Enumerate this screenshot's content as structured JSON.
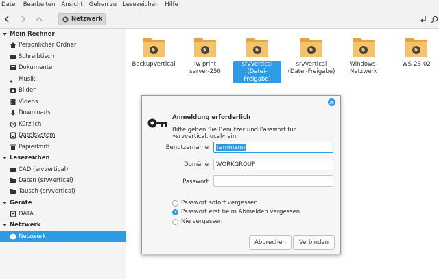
{
  "menubar": [
    "Datei",
    "Bearbeiten",
    "Ansicht",
    "Gehen zu",
    "Lesezeichen",
    "Hilfe"
  ],
  "toolbar": {
    "location": "Netzwerk"
  },
  "sidebar": {
    "sections": [
      {
        "title": "Mein Rechner",
        "items": [
          {
            "label": "Persönlicher Ordner",
            "icon": "home-icon"
          },
          {
            "label": "Schreibtisch",
            "icon": "desktop-icon"
          },
          {
            "label": "Dokumente",
            "icon": "documents-icon"
          },
          {
            "label": "Musik",
            "icon": "music-icon"
          },
          {
            "label": "Bilder",
            "icon": "pictures-icon"
          },
          {
            "label": "Videos",
            "icon": "videos-icon"
          },
          {
            "label": "Downloads",
            "icon": "downloads-icon"
          },
          {
            "label": "Kürzlich",
            "icon": "recent-icon"
          },
          {
            "label": "Dateisystem",
            "icon": "filesystem-icon"
          },
          {
            "label": "Papierkorb",
            "icon": "trash-icon"
          }
        ]
      },
      {
        "title": "Lesezeichen",
        "items": [
          {
            "label": "CAD (srvvertical)",
            "icon": "folder-icon"
          },
          {
            "label": "Daten (srvvertical)",
            "icon": "folder-icon"
          },
          {
            "label": "Tausch (srvvertical)",
            "icon": "folder-icon"
          }
        ]
      },
      {
        "title": "Geräte",
        "items": [
          {
            "label": "DATA",
            "icon": "drive-icon"
          }
        ]
      },
      {
        "title": "Netzwerk",
        "items": [
          {
            "label": "Netzwerk",
            "icon": "network-icon",
            "active": true
          }
        ]
      }
    ]
  },
  "content": {
    "items": [
      {
        "label": "BackupVertical"
      },
      {
        "label": "lw print server-250"
      },
      {
        "label": "srvVertical (Datei-Freigabe)",
        "selected": true
      },
      {
        "label": "srvVertical (Datei-Freigabe)"
      },
      {
        "label": "Windows-Netzwerk"
      },
      {
        "label": "WS-23-02"
      }
    ]
  },
  "dialog": {
    "title": "Anmeldung erforderlich",
    "message": "Bitte geben Sie Benutzer und Passwort für »srvvertical.local« ein:",
    "fields": {
      "username_label": "Benutzername",
      "username_value": "rammann",
      "domain_label": "Domäne",
      "domain_value": "WORKGROUP",
      "password_label": "Passwort",
      "password_value": ""
    },
    "options": [
      {
        "label": "Passwort sofort vergessen",
        "selected": false
      },
      {
        "label": "Passwort erst beim Abmelden vergessen",
        "selected": true
      },
      {
        "label": "Nie vergessen",
        "selected": false
      }
    ],
    "cancel_label": "Abbrechen",
    "connect_label": "Verbinden"
  },
  "colors": {
    "accent": "#2d9be6",
    "folder": "#f5c36b",
    "folder_dark": "#e2a445"
  }
}
